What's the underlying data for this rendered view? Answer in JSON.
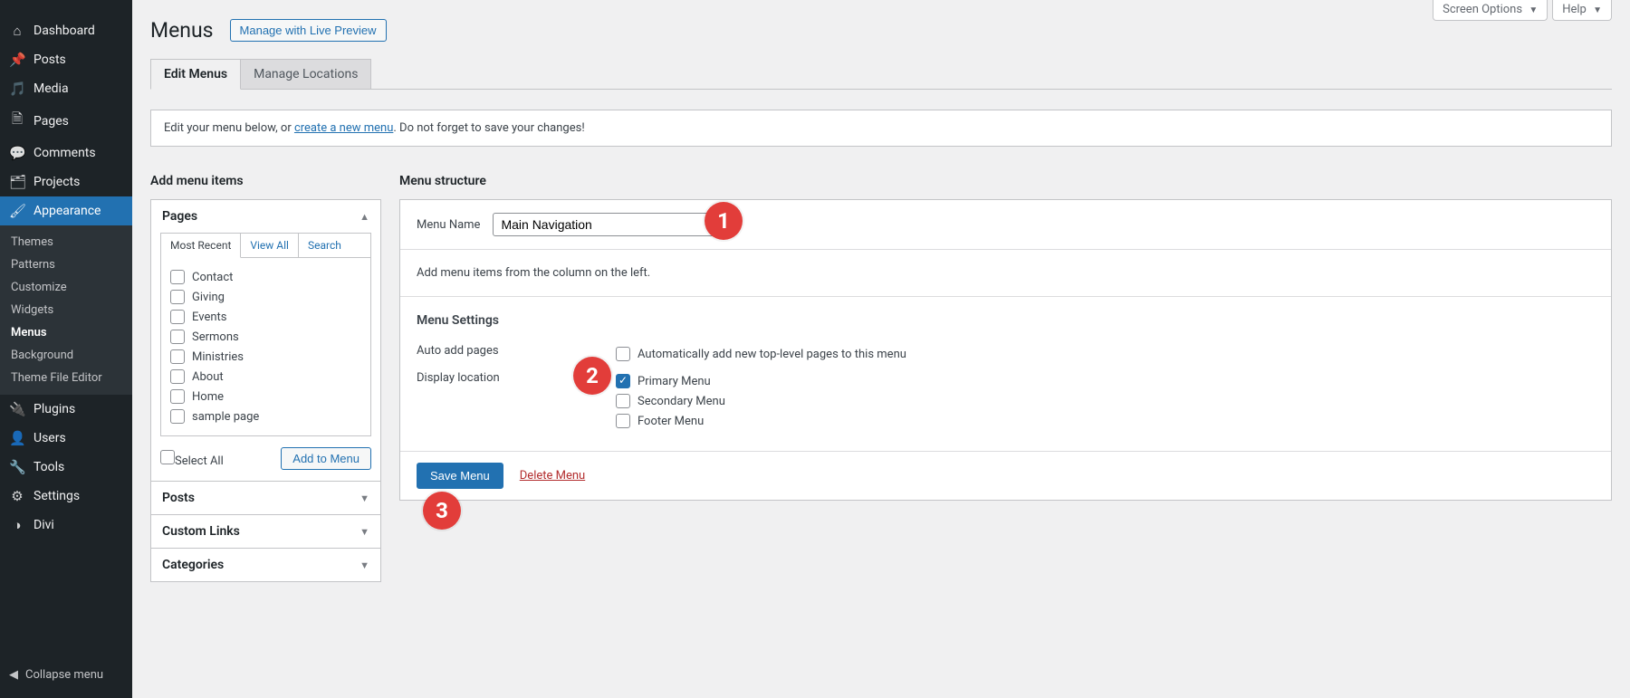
{
  "screen_meta": {
    "screen_options": "Screen Options",
    "help": "Help"
  },
  "sidebar": {
    "items": [
      {
        "icon": "dashboard",
        "label": "Dashboard"
      },
      {
        "icon": "pin",
        "label": "Posts"
      },
      {
        "icon": "media",
        "label": "Media"
      },
      {
        "icon": "page",
        "label": "Pages"
      },
      {
        "icon": "comment",
        "label": "Comments"
      },
      {
        "icon": "portfolio",
        "label": "Projects"
      },
      {
        "icon": "brush",
        "label": "Appearance"
      },
      {
        "icon": "plugin",
        "label": "Plugins"
      },
      {
        "icon": "user",
        "label": "Users"
      },
      {
        "icon": "wrench",
        "label": "Tools"
      },
      {
        "icon": "settings",
        "label": "Settings"
      },
      {
        "icon": "divi",
        "label": "Divi"
      }
    ],
    "sub": [
      "Themes",
      "Patterns",
      "Customize",
      "Widgets",
      "Menus",
      "Background",
      "Theme File Editor"
    ],
    "collapse": "Collapse menu"
  },
  "header": {
    "title": "Menus",
    "action": "Manage with Live Preview"
  },
  "tabs": {
    "edit": "Edit Menus",
    "locations": "Manage Locations"
  },
  "notice": {
    "prefix": "Edit your menu below, or ",
    "link": "create a new menu",
    "suffix": ". Do not forget to save your changes!"
  },
  "left": {
    "heading": "Add menu items",
    "pages_box": {
      "title": "Pages",
      "tabs": {
        "recent": "Most Recent",
        "all": "View All",
        "search": "Search"
      },
      "items": [
        "Contact",
        "Giving",
        "Events",
        "Sermons",
        "Ministries",
        "About",
        "Home",
        "sample page"
      ],
      "select_all": "Select All",
      "add": "Add to Menu"
    },
    "boxes": [
      "Posts",
      "Custom Links",
      "Categories"
    ]
  },
  "right": {
    "heading": "Menu structure",
    "name_label": "Menu Name",
    "name_value": "Main Navigation",
    "empty": "Add menu items from the column on the left.",
    "settings": {
      "title": "Menu Settings",
      "auto_label": "Auto add pages",
      "auto_option": "Automatically add new top-level pages to this menu",
      "loc_label": "Display location",
      "loc_options": [
        "Primary Menu",
        "Secondary Menu",
        "Footer Menu"
      ]
    },
    "save": "Save Menu",
    "delete": "Delete Menu"
  },
  "badges": [
    "1",
    "2",
    "3"
  ]
}
